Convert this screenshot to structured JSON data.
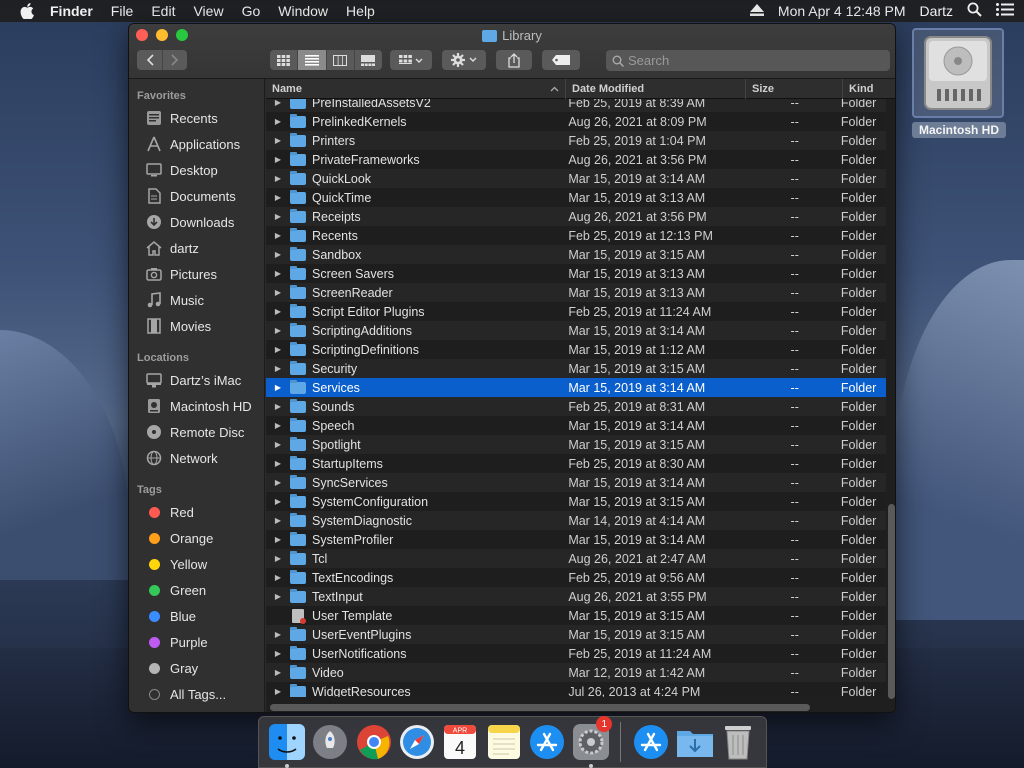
{
  "menubar": {
    "items": [
      "Finder",
      "File",
      "Edit",
      "View",
      "Go",
      "Window",
      "Help"
    ],
    "clock": "Mon Apr 4  12:48 PM",
    "user": "Dartz"
  },
  "window": {
    "title": "Library",
    "search_placeholder": "Search"
  },
  "sidebar": {
    "favorites_label": "Favorites",
    "favorites": [
      {
        "label": "Recents",
        "icon": "clock-icon"
      },
      {
        "label": "Applications",
        "icon": "applications-icon"
      },
      {
        "label": "Desktop",
        "icon": "desktop-icon"
      },
      {
        "label": "Documents",
        "icon": "documents-icon"
      },
      {
        "label": "Downloads",
        "icon": "downloads-icon"
      },
      {
        "label": "dartz",
        "icon": "home-icon"
      },
      {
        "label": "Pictures",
        "icon": "camera-icon"
      },
      {
        "label": "Music",
        "icon": "music-icon"
      },
      {
        "label": "Movies",
        "icon": "film-icon"
      }
    ],
    "locations_label": "Locations",
    "locations": [
      {
        "label": "Dartz’s iMac",
        "icon": "imac-icon"
      },
      {
        "label": "Macintosh HD",
        "icon": "disk-icon"
      },
      {
        "label": "Remote Disc",
        "icon": "disc-icon"
      },
      {
        "label": "Network",
        "icon": "network-icon"
      }
    ],
    "tags_label": "Tags",
    "tags": [
      {
        "label": "Red",
        "color": "#ff5a52"
      },
      {
        "label": "Orange",
        "color": "#ff9f1a"
      },
      {
        "label": "Yellow",
        "color": "#ffd60a"
      },
      {
        "label": "Green",
        "color": "#34c759"
      },
      {
        "label": "Blue",
        "color": "#3a8cff"
      },
      {
        "label": "Purple",
        "color": "#bf5af2"
      },
      {
        "label": "Gray",
        "color": "#b5b5b5"
      }
    ],
    "all_tags": "All Tags..."
  },
  "columns": {
    "name": "Name",
    "date": "Date Modified",
    "size": "Size",
    "kind": "Kind"
  },
  "rows": [
    {
      "name": "PreInstalledAssetsV2",
      "date": "Feb 25, 2019 at 8:39 AM",
      "size": "--",
      "kind": "Folder"
    },
    {
      "name": "PrelinkedKernels",
      "date": "Aug 26, 2021 at 8:09 PM",
      "size": "--",
      "kind": "Folder"
    },
    {
      "name": "Printers",
      "date": "Feb 25, 2019 at 1:04 PM",
      "size": "--",
      "kind": "Folder"
    },
    {
      "name": "PrivateFrameworks",
      "date": "Aug 26, 2021 at 3:56 PM",
      "size": "--",
      "kind": "Folder"
    },
    {
      "name": "QuickLook",
      "date": "Mar 15, 2019 at 3:14 AM",
      "size": "--",
      "kind": "Folder"
    },
    {
      "name": "QuickTime",
      "date": "Mar 15, 2019 at 3:13 AM",
      "size": "--",
      "kind": "Folder"
    },
    {
      "name": "Receipts",
      "date": "Aug 26, 2021 at 3:56 PM",
      "size": "--",
      "kind": "Folder"
    },
    {
      "name": "Recents",
      "date": "Feb 25, 2019 at 12:13 PM",
      "size": "--",
      "kind": "Folder"
    },
    {
      "name": "Sandbox",
      "date": "Mar 15, 2019 at 3:15 AM",
      "size": "--",
      "kind": "Folder"
    },
    {
      "name": "Screen Savers",
      "date": "Mar 15, 2019 at 3:13 AM",
      "size": "--",
      "kind": "Folder"
    },
    {
      "name": "ScreenReader",
      "date": "Mar 15, 2019 at 3:13 AM",
      "size": "--",
      "kind": "Folder"
    },
    {
      "name": "Script Editor Plugins",
      "date": "Feb 25, 2019 at 11:24 AM",
      "size": "--",
      "kind": "Folder"
    },
    {
      "name": "ScriptingAdditions",
      "date": "Mar 15, 2019 at 3:14 AM",
      "size": "--",
      "kind": "Folder"
    },
    {
      "name": "ScriptingDefinitions",
      "date": "Mar 15, 2019 at 1:12 AM",
      "size": "--",
      "kind": "Folder"
    },
    {
      "name": "Security",
      "date": "Mar 15, 2019 at 3:15 AM",
      "size": "--",
      "kind": "Folder"
    },
    {
      "name": "Services",
      "date": "Mar 15, 2019 at 3:14 AM",
      "size": "--",
      "kind": "Folder",
      "selected": true
    },
    {
      "name": "Sounds",
      "date": "Feb 25, 2019 at 8:31 AM",
      "size": "--",
      "kind": "Folder"
    },
    {
      "name": "Speech",
      "date": "Mar 15, 2019 at 3:14 AM",
      "size": "--",
      "kind": "Folder"
    },
    {
      "name": "Spotlight",
      "date": "Mar 15, 2019 at 3:15 AM",
      "size": "--",
      "kind": "Folder"
    },
    {
      "name": "StartupItems",
      "date": "Feb 25, 2019 at 8:30 AM",
      "size": "--",
      "kind": "Folder"
    },
    {
      "name": "SyncServices",
      "date": "Mar 15, 2019 at 3:14 AM",
      "size": "--",
      "kind": "Folder"
    },
    {
      "name": "SystemConfiguration",
      "date": "Mar 15, 2019 at 3:15 AM",
      "size": "--",
      "kind": "Folder"
    },
    {
      "name": "SystemDiagnostic",
      "date": "Mar 14, 2019 at 4:14 AM",
      "size": "--",
      "kind": "Folder"
    },
    {
      "name": "SystemProfiler",
      "date": "Mar 15, 2019 at 3:14 AM",
      "size": "--",
      "kind": "Folder"
    },
    {
      "name": "Tcl",
      "date": "Aug 26, 2021 at 2:47 AM",
      "size": "--",
      "kind": "Folder"
    },
    {
      "name": "TextEncodings",
      "date": "Feb 25, 2019 at 9:56 AM",
      "size": "--",
      "kind": "Folder"
    },
    {
      "name": "TextInput",
      "date": "Aug 26, 2021 at 3:55 PM",
      "size": "--",
      "kind": "Folder"
    },
    {
      "name": "User Template",
      "date": "Mar 15, 2019 at 3:15 AM",
      "size": "--",
      "kind": "Folder",
      "locked": true
    },
    {
      "name": "UserEventPlugins",
      "date": "Mar 15, 2019 at 3:15 AM",
      "size": "--",
      "kind": "Folder"
    },
    {
      "name": "UserNotifications",
      "date": "Feb 25, 2019 at 11:24 AM",
      "size": "--",
      "kind": "Folder"
    },
    {
      "name": "Video",
      "date": "Mar 12, 2019 at 1:42 AM",
      "size": "--",
      "kind": "Folder"
    },
    {
      "name": "WidgetResources",
      "date": "Jul 26, 2013 at 4:24 PM",
      "size": "--",
      "kind": "Folder"
    }
  ],
  "desktop": {
    "disk_label": "Macintosh HD"
  },
  "dock": {
    "apps": [
      "Finder",
      "Launchpad",
      "Chrome",
      "Safari",
      "Calendar",
      "Notes",
      "App Store",
      "System Preferences",
      "App Store",
      "Downloads",
      "Trash"
    ],
    "calendar_month": "APR",
    "calendar_day": "4",
    "badge": "1"
  }
}
